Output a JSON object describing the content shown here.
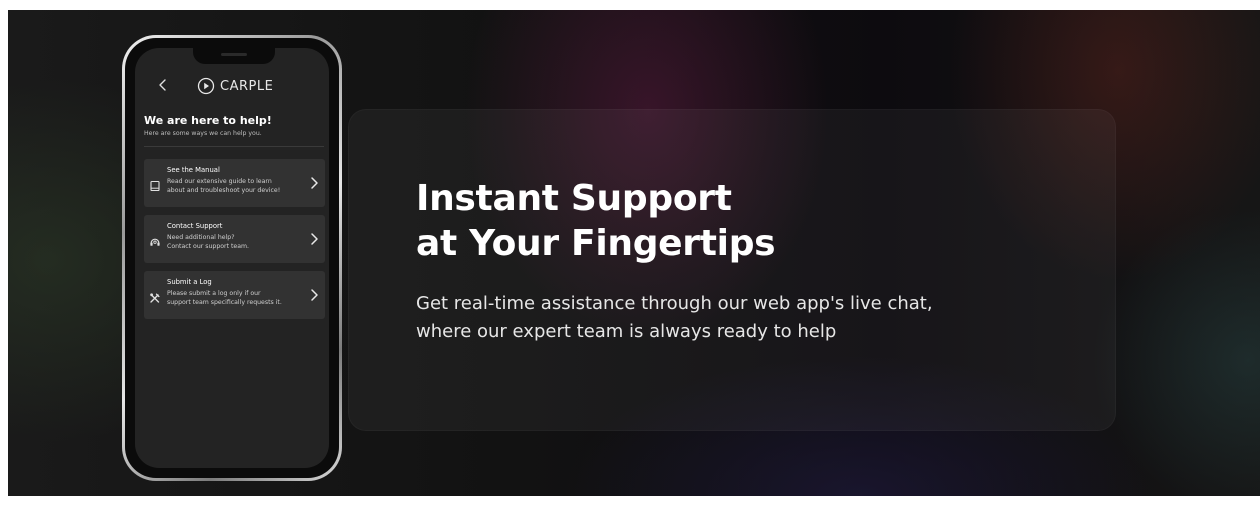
{
  "hero": {
    "headline_line1": "Instant Support",
    "headline_line2": "at Your Fingertips",
    "subtext_line1": "Get real-time assistance through our web app's live chat,",
    "subtext_line2": "where our expert team is always ready to help"
  },
  "phone": {
    "brand": "CARPLE",
    "brand_icon": "play-circle-icon",
    "back_icon": "chevron-left-icon",
    "title": "We are here to help!",
    "subtitle": "Here are some ways we can help you.",
    "options": [
      {
        "title": "See the Manual",
        "desc_line1": "Read our extensive guide to learn",
        "desc_line2": "about and troubleshoot your device!",
        "icon": "book-icon"
      },
      {
        "title": "Contact Support",
        "desc_line1": "Need additional help?",
        "desc_line2": "Contact our support team.",
        "icon": "headset-icon"
      },
      {
        "title": "Submit a Log",
        "desc_line1": "Please submit a log only if our",
        "desc_line2": "support team specifically requests it.",
        "icon": "tools-icon"
      }
    ]
  },
  "colors": {
    "screen_bg": "#232323",
    "card_bg": "#323232",
    "text_primary": "#ffffff",
    "text_secondary": "#cfcfcf"
  }
}
